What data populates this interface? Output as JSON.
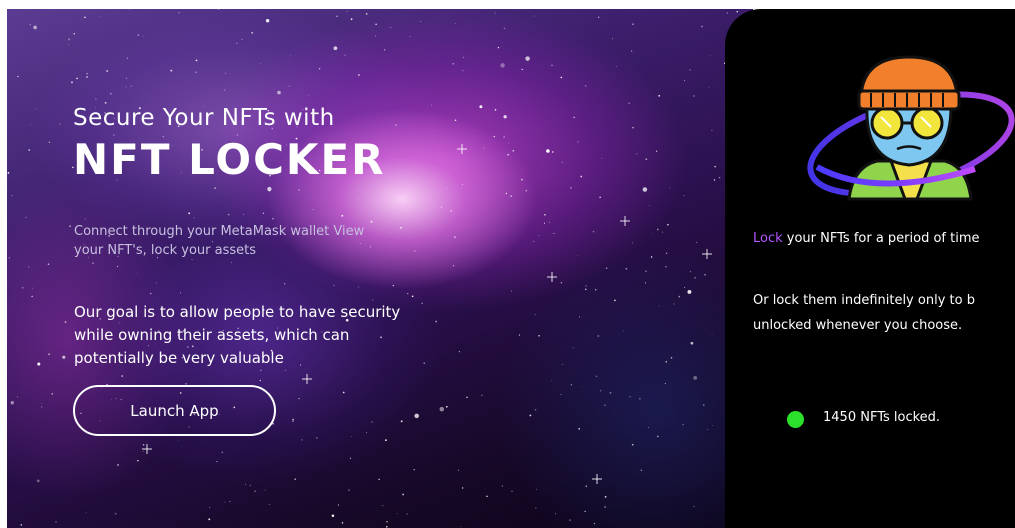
{
  "hero": {
    "subtitle": "Secure Your NFTs with",
    "title": "NFT LOCKER",
    "connect_line1": "Connect through your MetaMask wallet View",
    "connect_line2": "your NFT's, lock your assets",
    "goal_line1": "Our goal is to allow people to have security",
    "goal_line2": "while owning their assets, which can",
    "goal_line3": "potentially be very valuable",
    "launch_label": "Launch App"
  },
  "panel": {
    "lock_word": "Lock",
    "lock_rest": " your NFTs for a period of time",
    "indef_line1": "Or lock them indefinitely only to b",
    "indef_line2": "unlocked whenever you choose.",
    "status_text": "1450 NFTs locked."
  },
  "colors": {
    "accent": "#b055ff",
    "status_green": "#2ce12c",
    "panel_bg": "#000000"
  },
  "icons": {
    "mascot": "nft-mascot-avatar",
    "status": "status-dot-icon"
  }
}
